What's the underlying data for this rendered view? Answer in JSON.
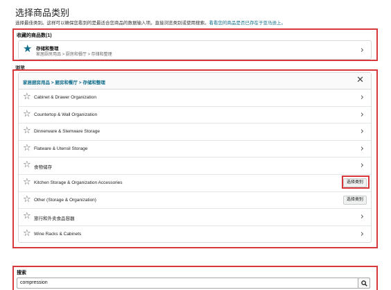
{
  "header": {
    "title": "选择商品类别",
    "subtitle": "选择最佳类别。这样可以确保您看到的是最适合您商品的数据输入项。直接浏览类别或使用搜索。",
    "subtitle_link": "看看您的商品是否已存在于亚马逊上。"
  },
  "favorites": {
    "label": "收藏的商品数(1)",
    "items": [
      {
        "name": "存储和整理",
        "path": "家居厨房用品 > 厨房和餐厅 > 存储和整理",
        "icon": "star-filled-icon"
      }
    ]
  },
  "browse": {
    "label": "浏览",
    "breadcrumb": "家居厨房用品 > 厨房和餐厅 > 存储和整理",
    "items": [
      {
        "label": "Cabinet & Drawer Organization",
        "action": "chevron"
      },
      {
        "label": "Countertop & Wall Organization",
        "action": "chevron"
      },
      {
        "label": "Dinnerware & Stemware Storage",
        "action": "chevron"
      },
      {
        "label": "Flatware & Utensil Storage",
        "action": "chevron"
      },
      {
        "label": "食物储存",
        "action": "chevron"
      },
      {
        "label": "Kitchen Storage & Organization Accessories",
        "action": "select"
      },
      {
        "label": "Other (Storage & Organization)",
        "action": "select"
      },
      {
        "label": "旅行和外卖食品容器",
        "action": "chevron"
      },
      {
        "label": "Wine Racks & Cabinets",
        "action": "chevron"
      }
    ],
    "select_label": "选择类别"
  },
  "search": {
    "label": "搜索",
    "value": "compression"
  },
  "colors": {
    "highlight": "#d9383a",
    "link": "#0f6c8a"
  }
}
